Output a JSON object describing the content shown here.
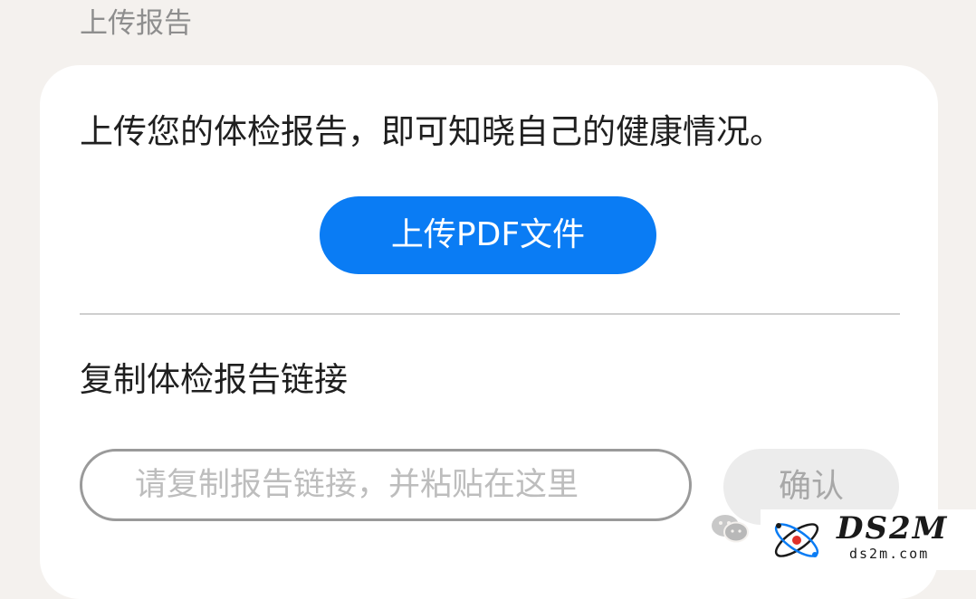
{
  "section": {
    "title": "上传报告"
  },
  "card": {
    "intro": "上传您的体检报告，即可知晓自己的健康情况。",
    "upload_button": "上传PDF文件",
    "copy_title": "复制体检报告链接",
    "link_input": {
      "placeholder": "请复制报告链接，并粘贴在这里",
      "value": ""
    },
    "confirm_button": "确认"
  },
  "watermark": {
    "name": "DS2M",
    "domain": "ds2m.com"
  },
  "colors": {
    "primary": "#0a7cf4",
    "background": "#f4f1ee",
    "card": "#ffffff",
    "disabled_button": "#ececec"
  },
  "icons": {
    "watermark_channel": "wechat-icon",
    "watermark_logo": "atom-logo-icon"
  }
}
